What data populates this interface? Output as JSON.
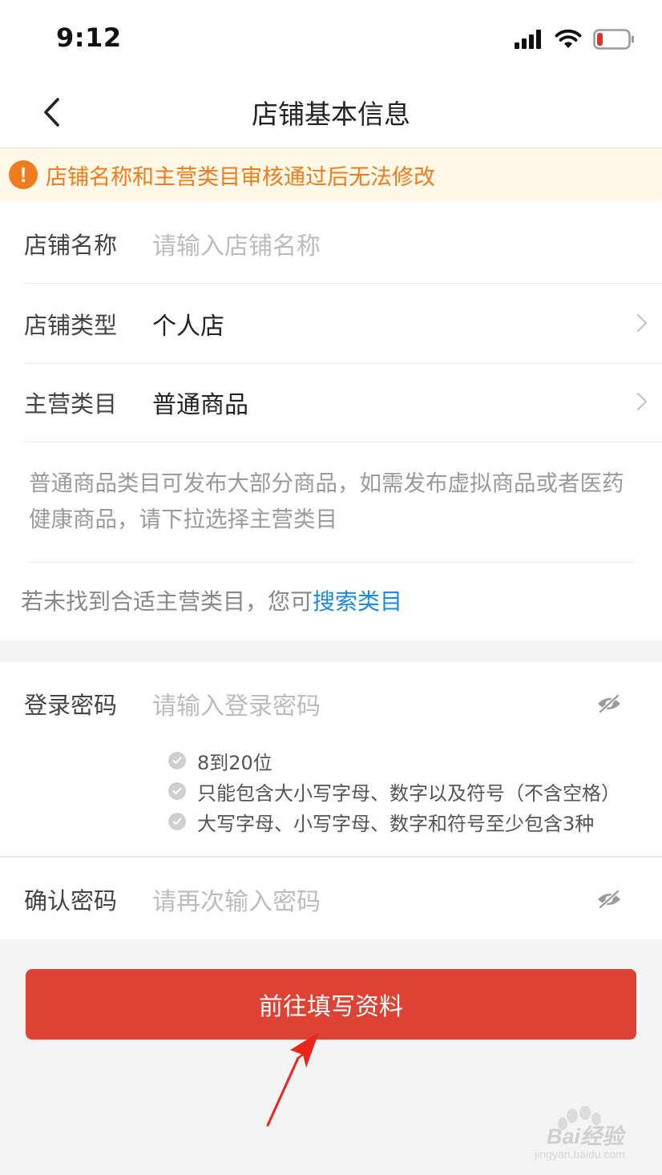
{
  "status_bar": {
    "time": "9:12"
  },
  "nav": {
    "title": "店铺基本信息"
  },
  "notice": {
    "text": "店铺名称和主营类目审核通过后无法修改",
    "color": "#f07c1e"
  },
  "form": {
    "shop_name": {
      "label": "店铺名称",
      "placeholder": "请输入店铺名称"
    },
    "shop_type": {
      "label": "店铺类型",
      "value": "个人店"
    },
    "main_category": {
      "label": "主营类目",
      "value": "普通商品"
    },
    "category_description": "普通商品类目可发布大部分商品，如需发布虚拟商品或者医药健康商品，请下拉选择主营类目",
    "search_hint": "若未找到合适主营类目，您可",
    "search_link": "搜索类目"
  },
  "password": {
    "login": {
      "label": "登录密码",
      "placeholder": "请输入登录密码"
    },
    "rules": [
      "8到20位",
      "只能包含大小写字母、数字以及符号（不含空格）",
      "大写字母、小写字母、数字和符号至少包含3种"
    ],
    "confirm": {
      "label": "确认密码",
      "placeholder": "请再次输入密码"
    }
  },
  "submit": {
    "label": "前往填写资料",
    "color": "#dc4334"
  },
  "watermark": {
    "brand": "Bai经验",
    "url": "jingyan.baidu.com"
  },
  "icons": {
    "back": "chevron-left-icon",
    "chevron": "chevron-right-icon",
    "eye": "eye-off-icon",
    "check": "check-circle-icon",
    "warning": "warning-icon"
  }
}
